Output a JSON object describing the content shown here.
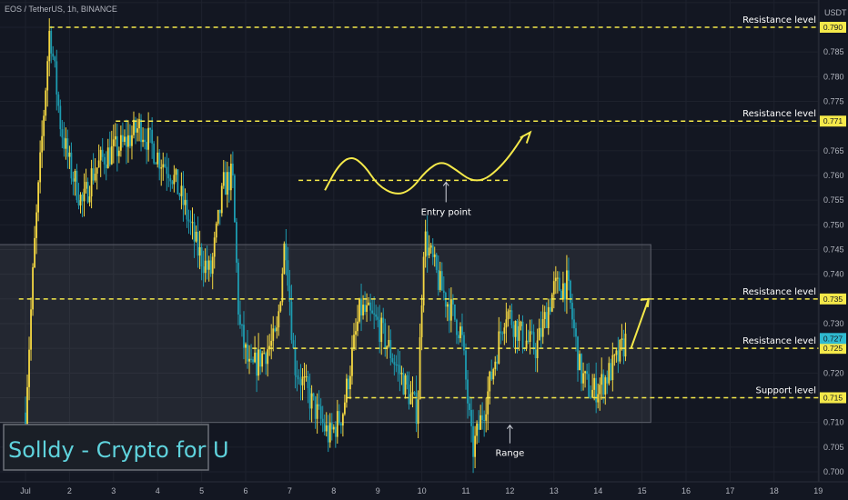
{
  "symbol_label": "EOS / TetherUS, 1h, BINANCE",
  "currency_label": "USDT",
  "watermark": "Solldy - Crypto for U",
  "colors": {
    "background": "#131722",
    "grid": "#1e222d",
    "bull": "#f5d842",
    "bear": "#1d9bb0",
    "level_line": "#f5e94a",
    "annotation": "#f5e94a",
    "range_box": "rgba(255,255,255,0.07)",
    "last_price_badge": "#2fbad0"
  },
  "chart_data": {
    "type": "candlestick",
    "title": "",
    "xlabel": "",
    "ylabel": "",
    "x_ticks": [
      "Jul",
      "2",
      "3",
      "4",
      "5",
      "6",
      "7",
      "8",
      "9",
      "10",
      "11",
      "12",
      "13",
      "14",
      "15",
      "16",
      "17",
      "18",
      "19"
    ],
    "y_ticks": [
      "0.785",
      "0.780",
      "0.775",
      "0.765",
      "0.760",
      "0.755",
      "0.750",
      "0.745",
      "0.740",
      "0.730",
      "0.720",
      "0.710",
      "0.705",
      "0.700"
    ],
    "ylim": [
      0.699,
      0.794
    ],
    "last_price": "0.727",
    "key_path": [
      [
        0.0,
        0.712
      ],
      [
        0.2,
        0.745
      ],
      [
        0.55,
        0.79
      ],
      [
        0.8,
        0.77
      ],
      [
        1.0,
        0.762
      ],
      [
        1.3,
        0.754
      ],
      [
        1.5,
        0.76
      ],
      [
        1.8,
        0.764
      ],
      [
        2.2,
        0.766
      ],
      [
        2.6,
        0.77
      ],
      [
        3.0,
        0.764
      ],
      [
        3.3,
        0.761
      ],
      [
        3.6,
        0.754
      ],
      [
        3.9,
        0.745
      ],
      [
        4.2,
        0.74
      ],
      [
        4.5,
        0.758
      ],
      [
        4.7,
        0.76
      ],
      [
        4.85,
        0.73
      ],
      [
        5.1,
        0.72
      ],
      [
        5.4,
        0.724
      ],
      [
        5.7,
        0.727
      ],
      [
        5.9,
        0.748
      ],
      [
        6.1,
        0.722
      ],
      [
        6.5,
        0.714
      ],
      [
        6.9,
        0.707
      ],
      [
        7.2,
        0.712
      ],
      [
        7.6,
        0.733
      ],
      [
        8.0,
        0.73
      ],
      [
        8.4,
        0.722
      ],
      [
        8.9,
        0.712
      ],
      [
        9.05,
        0.748
      ],
      [
        9.4,
        0.738
      ],
      [
        9.9,
        0.728
      ],
      [
        10.15,
        0.704
      ],
      [
        10.5,
        0.716
      ],
      [
        10.9,
        0.733
      ],
      [
        11.3,
        0.727
      ],
      [
        11.6,
        0.725
      ],
      [
        12.0,
        0.737
      ],
      [
        12.3,
        0.738
      ],
      [
        12.6,
        0.72
      ],
      [
        12.85,
        0.716
      ],
      [
        13.1,
        0.718
      ],
      [
        13.4,
        0.722
      ],
      [
        13.65,
        0.727
      ]
    ],
    "horizontal_levels": [
      {
        "price": 0.79,
        "label": "Resistance level",
        "badge": "0.790",
        "x_start": 0.55
      },
      {
        "price": 0.771,
        "label": "Resistance level",
        "badge": "0.771",
        "x_start": 2.05
      },
      {
        "price": 0.735,
        "label": "Resistance level",
        "badge": "0.735",
        "x_start": -0.15
      },
      {
        "price": 0.725,
        "label": "Resistance level",
        "badge": "0.725",
        "x_start": 5.15
      },
      {
        "price": 0.715,
        "label": "Support level",
        "badge": "0.715",
        "x_start": 7.3
      }
    ],
    "range_box": {
      "x0": -0.6,
      "x1": 14.2,
      "y_top": 0.746,
      "y_bottom": 0.71,
      "label": "Range"
    },
    "entry_line": {
      "x0": 6.2,
      "x1": 11.0,
      "price": 0.759,
      "label": "Entry point"
    },
    "projection_wave": [
      [
        6.8,
        0.757
      ],
      [
        7.1,
        0.762
      ],
      [
        7.4,
        0.764
      ],
      [
        7.7,
        0.762
      ],
      [
        8.0,
        0.758
      ],
      [
        8.4,
        0.756
      ],
      [
        8.75,
        0.757
      ],
      [
        9.1,
        0.761
      ],
      [
        9.45,
        0.763
      ],
      [
        9.8,
        0.761
      ],
      [
        10.1,
        0.759
      ],
      [
        10.4,
        0.759
      ],
      [
        10.7,
        0.761
      ],
      [
        11.0,
        0.764
      ],
      [
        11.3,
        0.768
      ]
    ],
    "arrow_up_to": [
      11.4,
      0.768
    ],
    "projection_arrow": {
      "from": [
        13.75,
        0.725
      ],
      "to": [
        14.15,
        0.735
      ]
    }
  }
}
